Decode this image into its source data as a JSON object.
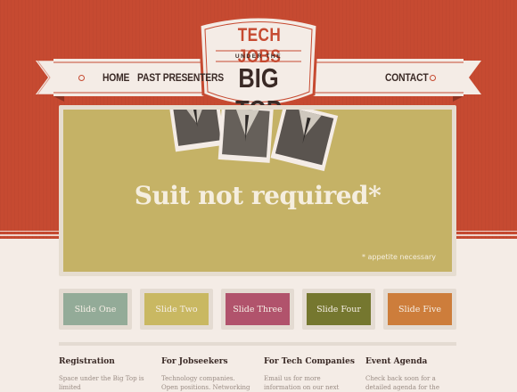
{
  "nav": {
    "home": "HOME",
    "past_presenters": "PAST PRESENTERS",
    "contact": "CONTACT"
  },
  "badge": {
    "top": "TECH JOBS",
    "middle": "UNDER THE",
    "bottom": "BIG TOP"
  },
  "hero": {
    "title": "Suit not required*",
    "note": "* appetite necessary"
  },
  "slides": [
    {
      "label": "Slide One",
      "color": "#93ab98"
    },
    {
      "label": "Slide Two",
      "color": "#c9b862"
    },
    {
      "label": "Slide Three",
      "color": "#b1536c"
    },
    {
      "label": "Slide Four",
      "color": "#75772f"
    },
    {
      "label": "Slide Five",
      "color": "#cd7d3b"
    }
  ],
  "columns": [
    {
      "title": "Registration",
      "text": "Space under the Big Top is limited"
    },
    {
      "title": "For Jobseekers",
      "text": "Technology companies. Open positions. Networking"
    },
    {
      "title": "For Tech Companies",
      "text": "Email us for more information on our next event"
    },
    {
      "title": "Event Agenda",
      "text": "Check back soon for a detailed agenda for the"
    }
  ],
  "colors": {
    "brand_red": "#c64a31",
    "cream": "#f4ece6",
    "dark_text": "#3a2a26",
    "hero_gold": "#c5b266"
  }
}
